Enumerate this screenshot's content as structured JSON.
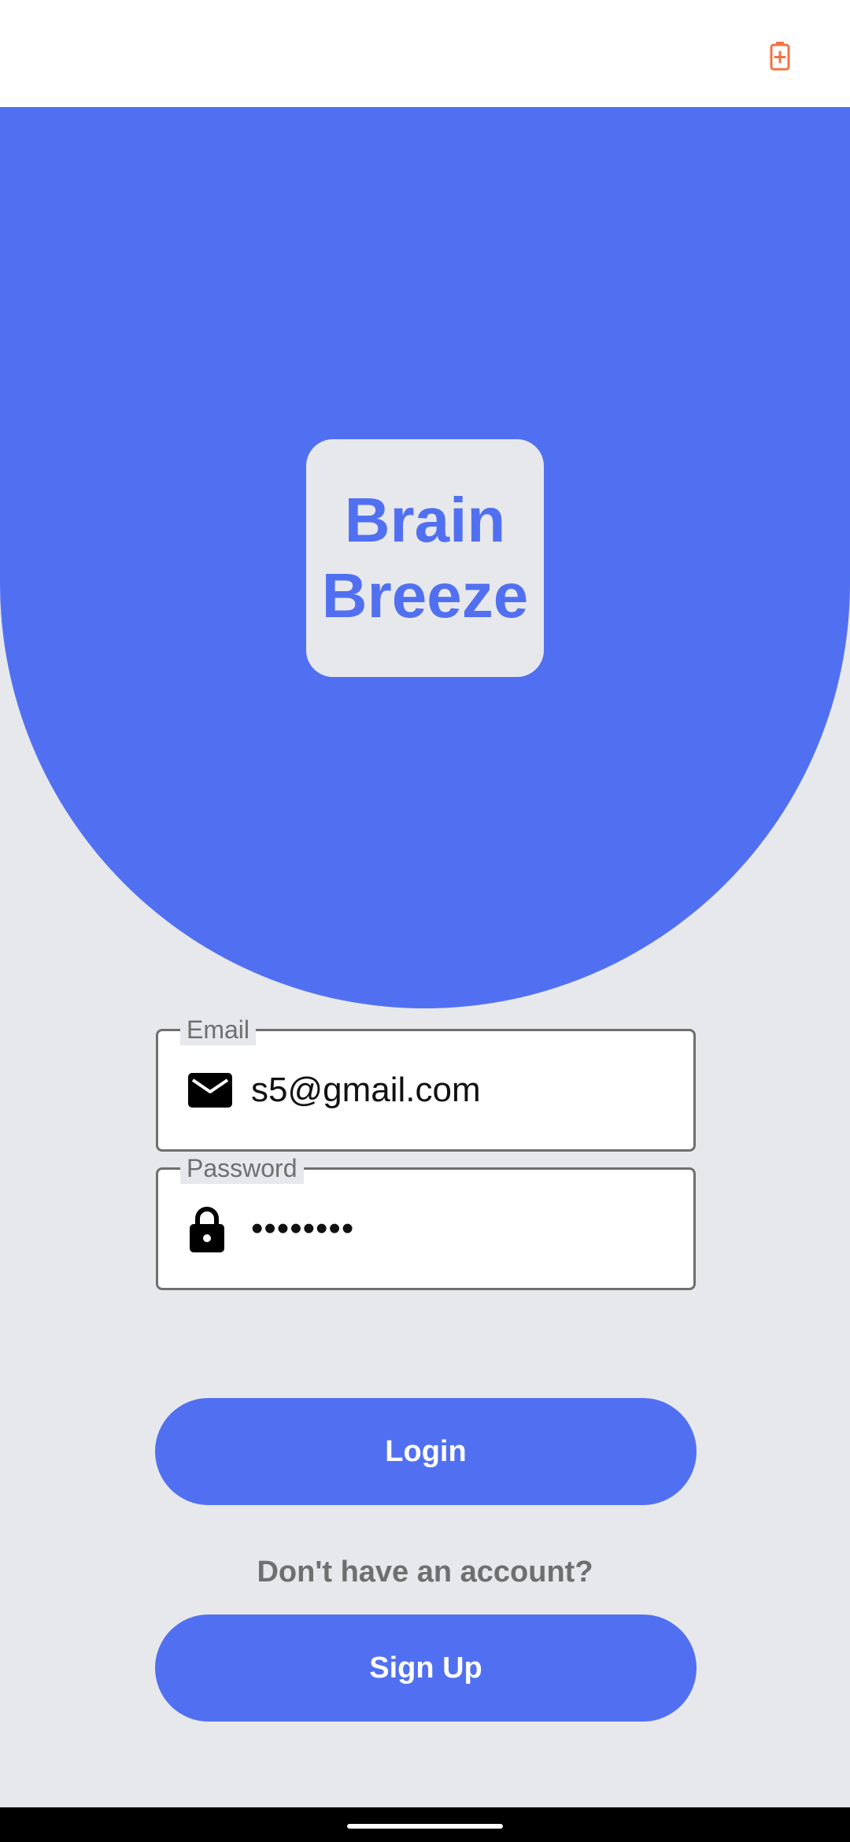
{
  "status_bar": {
    "battery_icon": "battery-charging-icon",
    "battery_color": "#f47341"
  },
  "app": {
    "logo_line1": "Brain",
    "logo_line2": "Breeze",
    "accent_color": "#5170f1",
    "background_color": "#e7e8eb"
  },
  "form": {
    "email": {
      "label": "Email",
      "value": "s5@gmail.com",
      "icon": "mail-icon"
    },
    "password": {
      "label": "Password",
      "value": "••••••••",
      "icon": "lock-icon"
    },
    "login_label": "Login",
    "prompt": "Don't have an account?",
    "signup_label": "Sign Up"
  }
}
